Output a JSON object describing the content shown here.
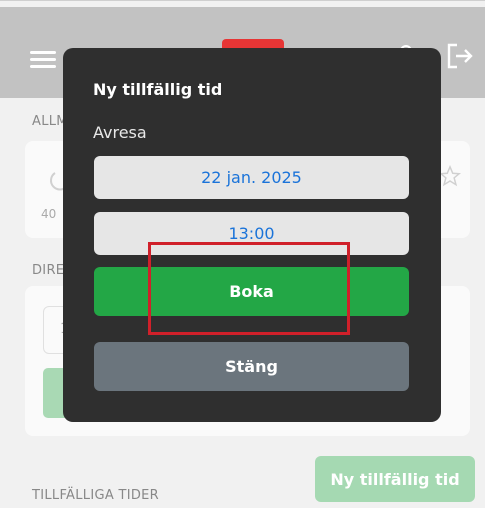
{
  "background": {
    "sections": {
      "first": "ALLM",
      "second": "DIRE",
      "third": "TILLFÄLLIGA TIDER"
    },
    "card_text": "40",
    "card_input_text": "1",
    "new_time_button": "Ny tillfällig tid"
  },
  "modal": {
    "title": "Ny tillfällig tid",
    "label": "Avresa",
    "date_value": "22 jan. 2025",
    "time_value": "13:00",
    "book_label": "Boka",
    "close_label": "Stäng"
  },
  "colors": {
    "modal_bg": "#2f2f2f",
    "book_green": "#23a746",
    "close_grey": "#6b757d",
    "field_text_blue": "#1a73d9",
    "highlight_red": "#d0202a"
  }
}
